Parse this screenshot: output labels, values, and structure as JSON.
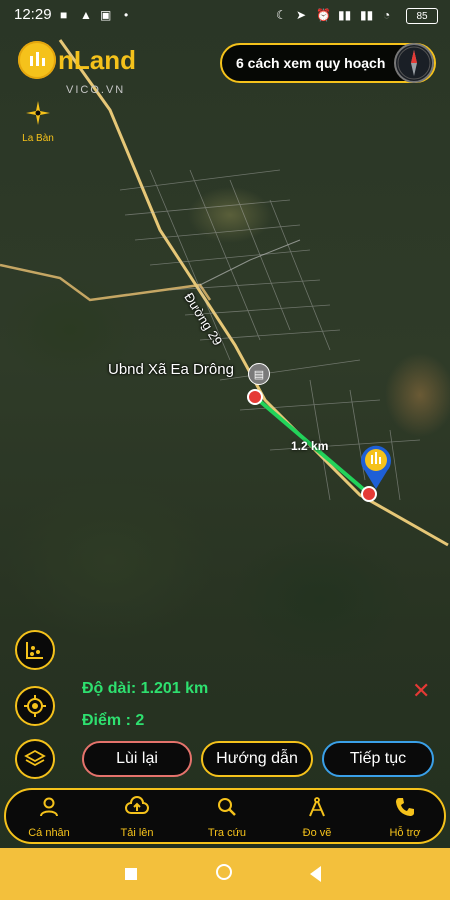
{
  "status_bar": {
    "time": "12:29",
    "battery": "85"
  },
  "brand": {
    "name": "nLand",
    "sub": "VICO.VN"
  },
  "top_pill": {
    "label": "6 cách xem quy hoạch"
  },
  "compass_label": "La Bàn",
  "map": {
    "labels": {
      "road": "Đường 29",
      "place": "Ubnd Xã Ea Drông",
      "distance": "1.2 km"
    }
  },
  "measure": {
    "length_label": "Độ dài: 1.201 km",
    "points_label": "Điểm : 2"
  },
  "actions": {
    "back": "Lùi lại",
    "guide": "Hướng dẫn",
    "continue": "Tiếp tục"
  },
  "nav": {
    "items": [
      {
        "label": "Cá nhân",
        "icon": "person-icon"
      },
      {
        "label": "Tải lên",
        "icon": "cloud-upload-icon"
      },
      {
        "label": "Tra cứu",
        "icon": "search-icon"
      },
      {
        "label": "Đo vẽ",
        "icon": "compass-drawing-icon"
      },
      {
        "label": "Hỗ trợ",
        "icon": "phone-icon"
      }
    ]
  },
  "colors": {
    "accent": "#f5c21b",
    "measure_text": "#2ee06f",
    "back_border": "#e5736c",
    "continue_border": "#3aa0e8",
    "system_bar": "#f3c03c"
  }
}
